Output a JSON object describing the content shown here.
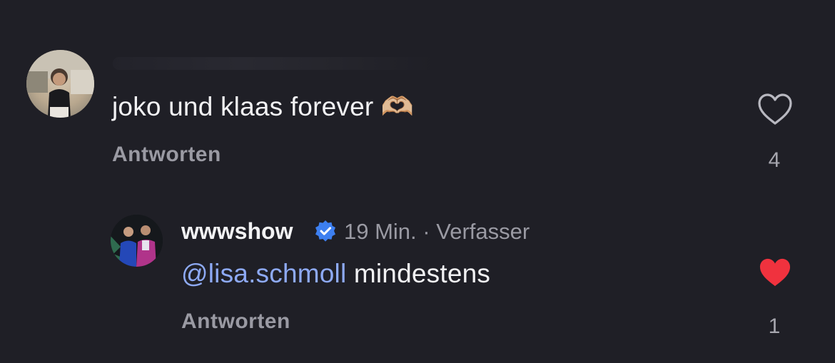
{
  "comments": [
    {
      "text": "joko und klaas forever 🫶🏼",
      "reply_label": "Antworten",
      "like_count": "4",
      "liked": false
    },
    {
      "username": "wwwshow",
      "verified": true,
      "time": "19 Min.",
      "separator": "·",
      "role": "Verfasser",
      "mention": "@lisa.schmoll",
      "text": "mindestens",
      "reply_label": "Antworten",
      "like_count": "1",
      "liked": true
    }
  ],
  "colors": {
    "background": "#1f1f26",
    "mention": "#8eaaf5",
    "verified_badge": "#3d7ff0",
    "heart_liked": "#f0323e",
    "muted_text": "#9a9aa3"
  },
  "icons": [
    "heart-outline-icon",
    "heart-filled-icon",
    "verified-badge-icon",
    "heart-hands-emoji"
  ]
}
